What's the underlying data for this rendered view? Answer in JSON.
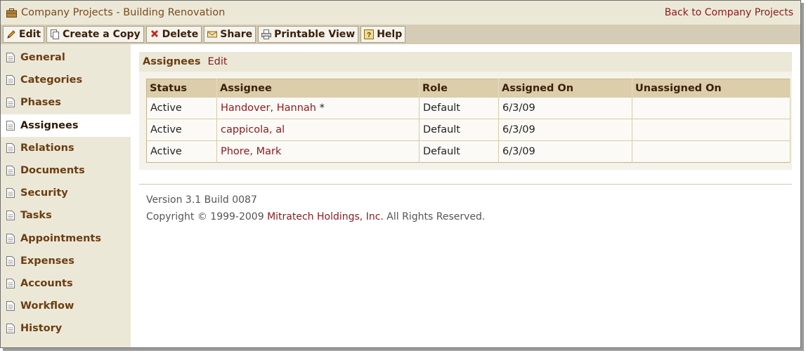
{
  "header": {
    "title": "Company Projects - Building Renovation",
    "back_link": "Back to Company Projects",
    "icon": "briefcase-icon"
  },
  "toolbar": {
    "buttons": [
      {
        "label": "Edit",
        "icon": "pencil-icon"
      },
      {
        "label": "Create a Copy",
        "icon": "copy-icon"
      },
      {
        "label": "Delete",
        "icon": "delete-x-icon"
      },
      {
        "label": "Share",
        "icon": "envelope-icon"
      },
      {
        "label": "Printable View",
        "icon": "printer-icon"
      },
      {
        "label": "Help",
        "icon": "help-icon"
      }
    ]
  },
  "sidebar": {
    "items": [
      {
        "label": "General"
      },
      {
        "label": "Categories"
      },
      {
        "label": "Phases"
      },
      {
        "label": "Assignees",
        "active": true
      },
      {
        "label": "Relations"
      },
      {
        "label": "Documents"
      },
      {
        "label": "Security"
      },
      {
        "label": "Tasks"
      },
      {
        "label": "Appointments"
      },
      {
        "label": "Expenses"
      },
      {
        "label": "Accounts"
      },
      {
        "label": "Workflow"
      },
      {
        "label": "History"
      }
    ]
  },
  "section": {
    "title": "Assignees",
    "edit_link": "Edit"
  },
  "table": {
    "columns": [
      "Status",
      "Assignee",
      "Role",
      "Assigned On",
      "Unassigned On"
    ],
    "rows": [
      {
        "status": "Active",
        "assignee": "Handover, Hannah",
        "marker": "*",
        "role": "Default",
        "assigned_on": "6/3/09",
        "unassigned_on": ""
      },
      {
        "status": "Active",
        "assignee": "cappicola, al",
        "marker": "",
        "role": "Default",
        "assigned_on": "6/3/09",
        "unassigned_on": ""
      },
      {
        "status": "Active",
        "assignee": "Phore, Mark",
        "marker": "",
        "role": "Default",
        "assigned_on": "6/3/09",
        "unassigned_on": ""
      }
    ]
  },
  "footer": {
    "version": "Version 3.1 Build 0087",
    "copyright_prefix": "Copyright © 1999-2009 ",
    "company_link": "Mitratech Holdings, Inc.",
    "copyright_suffix": " All Rights Reserved."
  },
  "colors": {
    "accent_link": "#8b1a1a",
    "nav_text": "#6b3d10",
    "panel_bg": "#ece8d8",
    "toolbar_bg": "#d4ccb4",
    "table_header_bg": "#dcceaa"
  }
}
